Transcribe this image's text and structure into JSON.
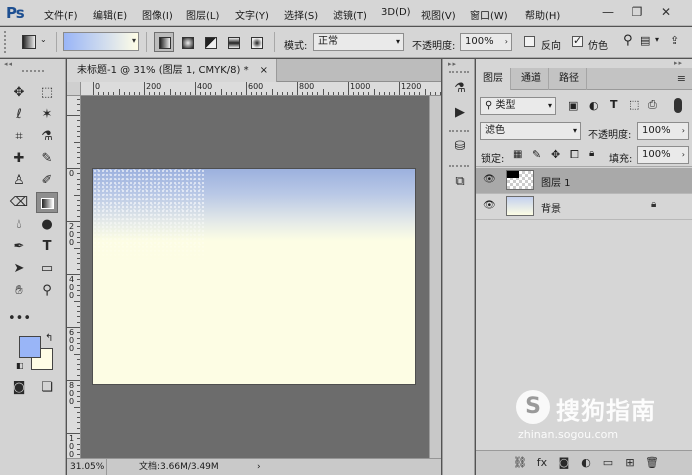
{
  "app": {
    "logo": "Ps"
  },
  "menu": [
    "文件(F)",
    "编辑(E)",
    "图像(I)",
    "图层(L)",
    "文字(Y)",
    "选择(S)",
    "滤镜(T)",
    "3D(D)",
    "视图(V)",
    "窗口(W)",
    "帮助(H)"
  ],
  "window_controls": {
    "minimize": "—",
    "restore": "❐",
    "close": "✕"
  },
  "options": {
    "gradient_colors": [
      "#99b5f7",
      "#fffde6"
    ],
    "mode_label": "模式:",
    "mode_value": "正常",
    "opacity_label": "不透明度:",
    "opacity_value": "100%",
    "reverse_label": "反向",
    "reverse_checked": false,
    "dither_label": "仿色",
    "dither_checked": true
  },
  "document": {
    "tab_title": "未标题-1 @ 31% (图层 1, CMYK/8) *",
    "tab_close": "×",
    "ruler_h_labels": [
      "0",
      "200",
      "400",
      "600",
      "800",
      "1000",
      "1200"
    ],
    "ruler_v_labels": [
      "0",
      "200",
      "400",
      "600",
      "800",
      "1000"
    ],
    "zoom": "31.05%",
    "doc_info": "文档:3.66M/3.49M"
  },
  "layers_panel": {
    "tabs": [
      "图层",
      "通道",
      "路径"
    ],
    "filter_kind": "类型",
    "blend_mode": "滤色",
    "opacity_label": "不透明度:",
    "opacity_value": "100%",
    "lock_label": "锁定:",
    "fill_label": "填充:",
    "fill_value": "100%",
    "layers": [
      {
        "name": "图层 1",
        "selected": true,
        "visible": true
      },
      {
        "name": "背景",
        "selected": false,
        "visible": true,
        "locked": true
      }
    ]
  },
  "watermark": {
    "brand": "搜狗指南",
    "url": "zhinan.sogou.com"
  },
  "colors": {
    "foreground": "#99b5f7",
    "background": "#fffde6",
    "ui_gray": "#d6d6d6",
    "canvas_bg": "#6b6b6b"
  }
}
